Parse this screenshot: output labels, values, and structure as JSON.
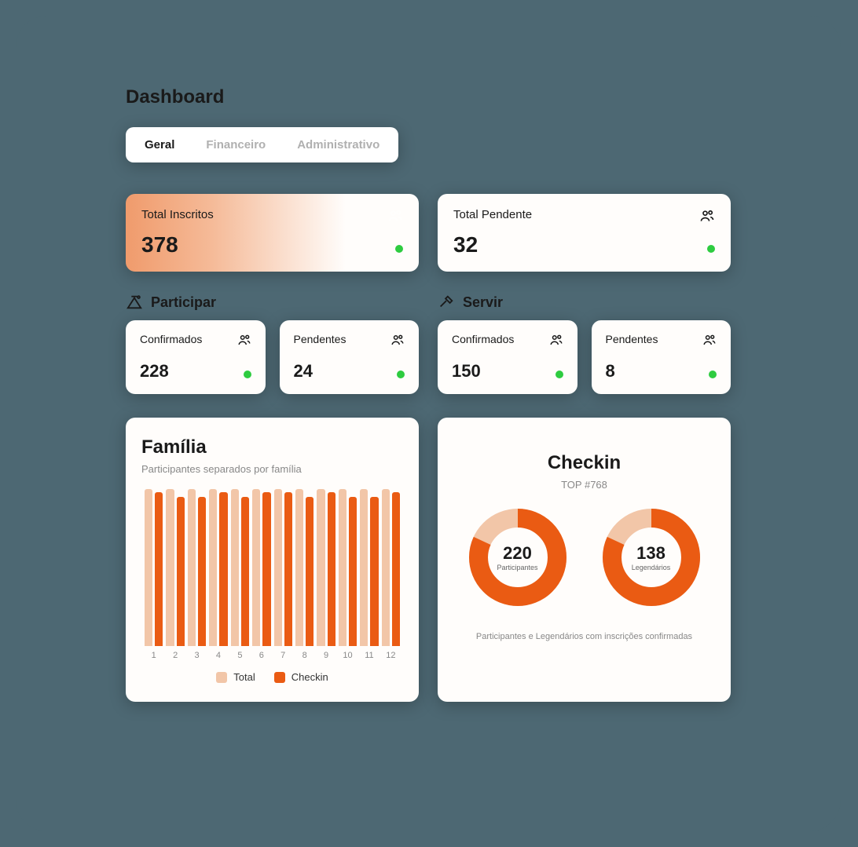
{
  "page_title": "Dashboard",
  "tabs": {
    "geral": "Geral",
    "financeiro": "Financeiro",
    "administrativo": "Administrativo"
  },
  "totals": {
    "inscritos": {
      "label": "Total Inscritos",
      "value": "378"
    },
    "pendente": {
      "label": "Total Pendente",
      "value": "32"
    }
  },
  "sections": {
    "participar": {
      "title": "Participar",
      "confirmados": {
        "label": "Confirmados",
        "value": "228"
      },
      "pendentes": {
        "label": "Pendentes",
        "value": "24"
      }
    },
    "servir": {
      "title": "Servir",
      "confirmados": {
        "label": "Confirmados",
        "value": "150"
      },
      "pendentes": {
        "label": "Pendentes",
        "value": "8"
      }
    }
  },
  "familia": {
    "title": "Família",
    "subtitle": "Participantes separados por família",
    "legend": {
      "total": "Total",
      "checkin": "Checkin"
    }
  },
  "checkin_card": {
    "title": "Checkin",
    "subtitle": "TOP #768",
    "donut1": {
      "value": "220",
      "label": "Participantes"
    },
    "donut2": {
      "value": "138",
      "label": "Legendários"
    },
    "footer": "Participantes e Legendários com inscrições confirmadas"
  },
  "colors": {
    "accent": "#ea5b13",
    "accent_light": "#f2c6a8",
    "status_ok": "#2ecc40"
  },
  "chart_data": [
    {
      "type": "bar",
      "title": "Família",
      "subtitle": "Participantes separados por família",
      "categories": [
        "1",
        "2",
        "3",
        "4",
        "5",
        "6",
        "7",
        "8",
        "9",
        "10",
        "11",
        "12"
      ],
      "series": [
        {
          "name": "Total",
          "values": [
            100,
            100,
            100,
            100,
            100,
            100,
            100,
            100,
            100,
            100,
            100,
            100
          ]
        },
        {
          "name": "Checkin",
          "values": [
            98,
            95,
            95,
            98,
            95,
            98,
            98,
            95,
            98,
            95,
            95,
            98
          ]
        }
      ],
      "ylim": [
        0,
        100
      ]
    },
    {
      "type": "pie",
      "title": "Checkin",
      "subtitle": "TOP #768",
      "series": [
        {
          "name": "Participantes",
          "center_value": 220,
          "values": [
            82,
            18
          ]
        },
        {
          "name": "Legendários",
          "center_value": 138,
          "values": [
            82,
            18
          ]
        }
      ]
    }
  ]
}
